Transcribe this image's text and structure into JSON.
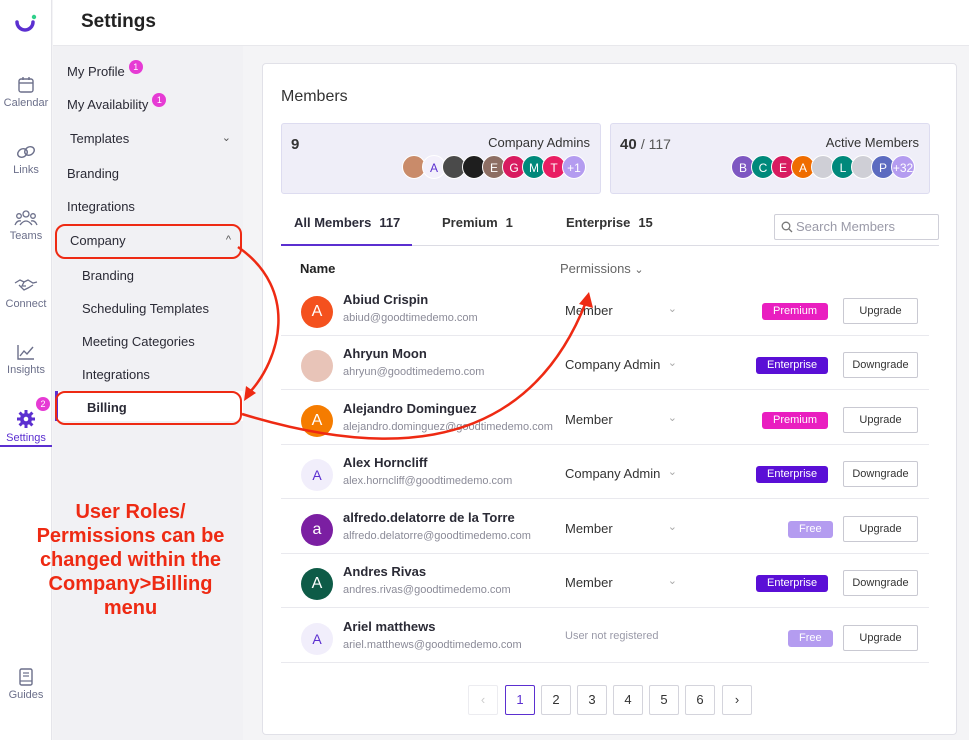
{
  "rail": {
    "items": [
      {
        "label": "Calendar",
        "icon": "calendar-icon"
      },
      {
        "label": "Links",
        "icon": "link-icon"
      },
      {
        "label": "Teams",
        "icon": "teams-icon"
      },
      {
        "label": "Connect",
        "icon": "handshake-icon"
      },
      {
        "label": "Insights",
        "icon": "chart-icon"
      },
      {
        "label": "Settings",
        "icon": "gear-icon",
        "badge": "2"
      },
      {
        "label": "Guides",
        "icon": "book-icon"
      }
    ]
  },
  "header": {
    "title": "Settings"
  },
  "settings_nav": {
    "my_profile": "My Profile",
    "my_profile_badge": "1",
    "my_availability": "My Availability",
    "my_availability_badge": "1",
    "templates": "Templates",
    "branding": "Branding",
    "integrations": "Integrations",
    "company": "Company",
    "company_branding": "Branding",
    "scheduling_templates": "Scheduling Templates",
    "meeting_categories": "Meeting Categories",
    "company_integrations": "Integrations",
    "billing": "Billing"
  },
  "members": {
    "title": "Members",
    "admins": {
      "count": "9",
      "label": "Company Admins",
      "extra": "+1"
    },
    "active": {
      "count": "40",
      "total": "/ 117",
      "label": "Active Members",
      "extra": "+32"
    },
    "tabs": [
      {
        "label": "All Members",
        "count": "117"
      },
      {
        "label": "Premium",
        "count": "1"
      },
      {
        "label": "Enterprise",
        "count": "15"
      }
    ],
    "search_placeholder": "Search Members",
    "col_name": "Name",
    "col_permissions": "Permissions",
    "rows": [
      {
        "initial": "A",
        "name": "Abiud Crispin",
        "email": "abiud@goodtimedemo.com",
        "role": "Member",
        "plan": "Premium",
        "action": "Upgrade"
      },
      {
        "initial": "",
        "name": "Ahryun Moon",
        "email": "ahryun@goodtimedemo.com",
        "role": "Company Admin",
        "plan": "Enterprise",
        "action": "Downgrade"
      },
      {
        "initial": "A",
        "name": "Alejandro Dominguez",
        "email": "alejandro.dominguez@goodtimedemo.com",
        "role": "Member",
        "plan": "Premium",
        "action": "Upgrade"
      },
      {
        "initial": "A",
        "name": "Alex Horncliff",
        "email": "alex.horncliff@goodtimedemo.com",
        "role": "Company Admin",
        "plan": "Enterprise",
        "action": "Downgrade"
      },
      {
        "initial": "a",
        "name": "alfredo.delatorre de la Torre",
        "email": "alfredo.delatorre@goodtimedemo.com",
        "role": "Member",
        "plan": "Free",
        "action": "Upgrade"
      },
      {
        "initial": "A",
        "name": "Andres Rivas",
        "email": "andres.rivas@goodtimedemo.com",
        "role": "Member",
        "plan": "Enterprise",
        "action": "Downgrade"
      },
      {
        "initial": "A",
        "name": "Ariel matthews",
        "email": "ariel.matthews@goodtimedemo.com",
        "role": "User not registered",
        "plan": "Free",
        "action": "Upgrade"
      }
    ],
    "pages": [
      "1",
      "2",
      "3",
      "4",
      "5",
      "6"
    ],
    "prev": "‹",
    "next": "›"
  },
  "annotation": {
    "line1": "User Roles/",
    "line2": "Permissions can be",
    "line3": "changed within the",
    "line4": "Company>Billing",
    "line5": "menu"
  },
  "colors": {
    "accent": "#5b2fd0",
    "premium": "#e91ec0",
    "enterprise": "#5a0fd6",
    "free": "#b49cf0",
    "annotation": "#ee2a13"
  }
}
